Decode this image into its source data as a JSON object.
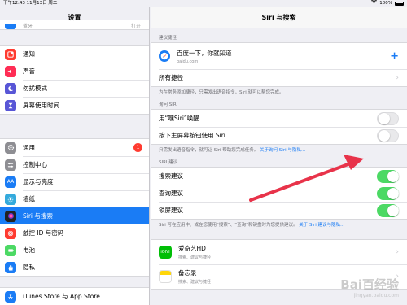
{
  "status_bar": {
    "time_date": "下午12:43  11月13日 周二",
    "battery": "100%"
  },
  "master": {
    "title": "设置",
    "partial_top_label": "蓝牙",
    "partial_top_value": "打开",
    "group1": [
      {
        "label": "通知",
        "icon": "bell-icon",
        "color": "#ff3b30"
      },
      {
        "label": "声音",
        "icon": "speaker-icon",
        "color": "#ff2d55"
      },
      {
        "label": "勿扰模式",
        "icon": "moon-icon",
        "color": "#5856d6"
      },
      {
        "label": "屏幕使用时间",
        "icon": "hourglass-icon",
        "color": "#5856d6"
      }
    ],
    "group2": [
      {
        "label": "通用",
        "icon": "gear-icon",
        "color": "#8e8e93",
        "badge": "1"
      },
      {
        "label": "控制中心",
        "icon": "control-center-icon",
        "color": "#8e8e93"
      },
      {
        "label": "显示与亮度",
        "icon": "display-icon",
        "color": "#1a7cf5"
      },
      {
        "label": "墙纸",
        "icon": "wallpaper-icon",
        "color": "#34aadc"
      },
      {
        "label": "Siri 与搜索",
        "icon": "siri-icon",
        "color": "#222222",
        "selected": true
      },
      {
        "label": "触控 ID 与密码",
        "icon": "fingerprint-icon",
        "color": "#ff3b30"
      },
      {
        "label": "电池",
        "icon": "battery-icon",
        "color": "#4cd964"
      },
      {
        "label": "隐私",
        "icon": "hand-icon",
        "color": "#1a7cf5"
      }
    ],
    "group3": [
      {
        "label": "iTunes Store 与 App Store",
        "icon": "app-store-icon",
        "color": "#1a7cf5"
      }
    ]
  },
  "detail": {
    "title": "Siri 与搜索",
    "shortcuts_header": "建议捷径",
    "shortcut_item": {
      "title": "百度一下，你就知道",
      "subtitle": "baidu.com"
    },
    "all_shortcuts": "所有捷径",
    "shortcuts_footer": "为在常务添加捷径，只需发出语音指令，Siri 就可以帮您完成。",
    "ask_siri_header": "询问 SIRI",
    "hey_siri": "用“嘿Siri”唤醒",
    "home_button": "按下主屏幕按钮使用 Siri",
    "ask_siri_footer": "只需发出语音指令，就可让 Siri 帮助您完成任务。",
    "ask_siri_footer_link": "关于询问 Siri 与隐私…",
    "suggestions_header": "SIRI 建议",
    "search_suggestions": "搜索建议",
    "lookup_suggestions": "查询建议",
    "lockscreen_suggestions": "锁屏建议",
    "suggestions_footer": "Siri 可在应用中、或在您使用“搜索”、“查询”和键盘时为您提供建议。",
    "suggestions_footer_link": "关于 Siri 建议与隐私…",
    "apps": [
      {
        "name": "爱奇艺HD",
        "sub": "搜索、建议与捷径",
        "icon_text": "iQIYI",
        "color": "#00be06"
      },
      {
        "name": "备忘录",
        "sub": "搜索、建议与捷径",
        "icon_text": "",
        "color": "#ffd60a"
      }
    ],
    "toggles": {
      "hey_siri": false,
      "home_button": false,
      "search": true,
      "lookup": true,
      "lockscreen": true
    }
  },
  "watermark": {
    "brand": "Bai百经验",
    "url": "jingyan.baidu.com"
  },
  "colors": {
    "accent": "#1a7cf5",
    "toggle_on": "#4cd964",
    "arrow": "#e8334a"
  }
}
